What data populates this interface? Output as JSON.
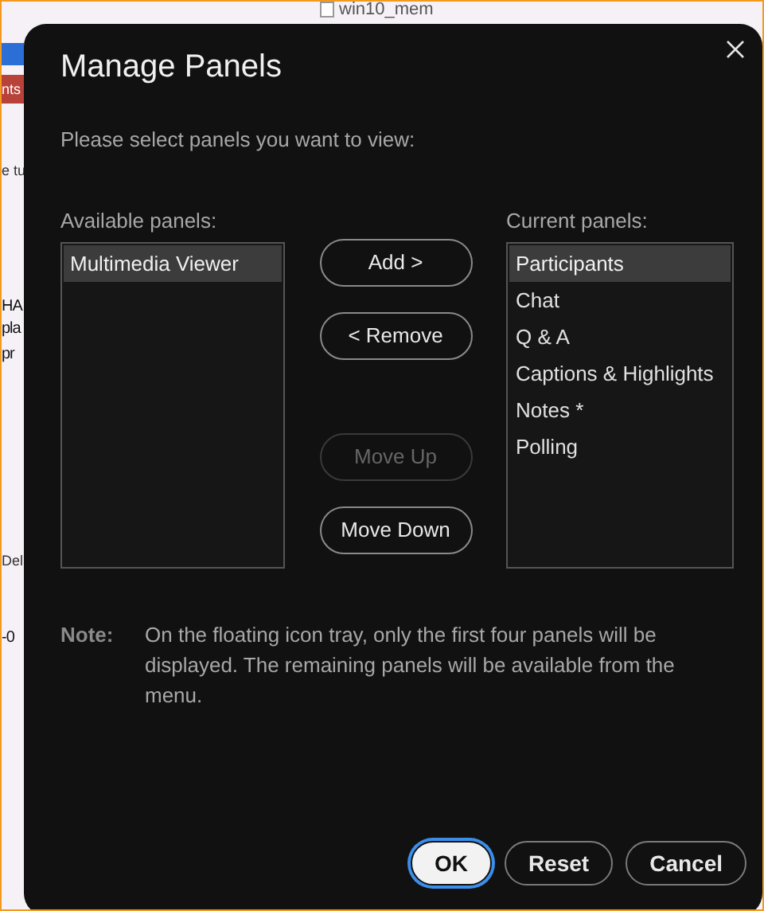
{
  "background_window": {
    "title": "win10_mem",
    "fragments": [
      {
        "text": "nts",
        "kind": "tab"
      },
      {
        "text": "e tu",
        "kind": "line"
      },
      {
        "text": "HA",
        "kind": "big"
      },
      {
        "text": "pla",
        "kind": "big"
      },
      {
        "text": "pr",
        "kind": "big"
      },
      {
        "text": "Del",
        "kind": "line"
      },
      {
        "text": "-0",
        "kind": "big"
      }
    ]
  },
  "dialog": {
    "title": "Manage Panels",
    "instruction": "Please select panels you want to view:",
    "available_label": "Available panels:",
    "available": [
      {
        "label": "Multimedia Viewer",
        "selected": true
      }
    ],
    "current_label": "Current panels:",
    "current": [
      {
        "label": "Participants",
        "selected": true
      },
      {
        "label": "Chat",
        "selected": false
      },
      {
        "label": "Q & A",
        "selected": false
      },
      {
        "label": "Captions & Highlights",
        "selected": false
      },
      {
        "label": "Notes *",
        "selected": false
      },
      {
        "label": "Polling",
        "selected": false
      }
    ],
    "transfer_buttons": [
      {
        "label": "Add >",
        "disabled": false
      },
      {
        "label": "< Remove",
        "disabled": false
      }
    ],
    "order_buttons": [
      {
        "label": "Move Up",
        "disabled": true
      },
      {
        "label": "Move Down",
        "disabled": false
      }
    ],
    "note_label": "Note:",
    "note": "On the floating icon tray, only the first four panels will be displayed. The remaining panels will be available from the menu.",
    "footer_buttons": [
      {
        "label": "OK",
        "default": true
      },
      {
        "label": "Reset",
        "default": false
      },
      {
        "label": "Cancel",
        "default": false
      }
    ]
  }
}
